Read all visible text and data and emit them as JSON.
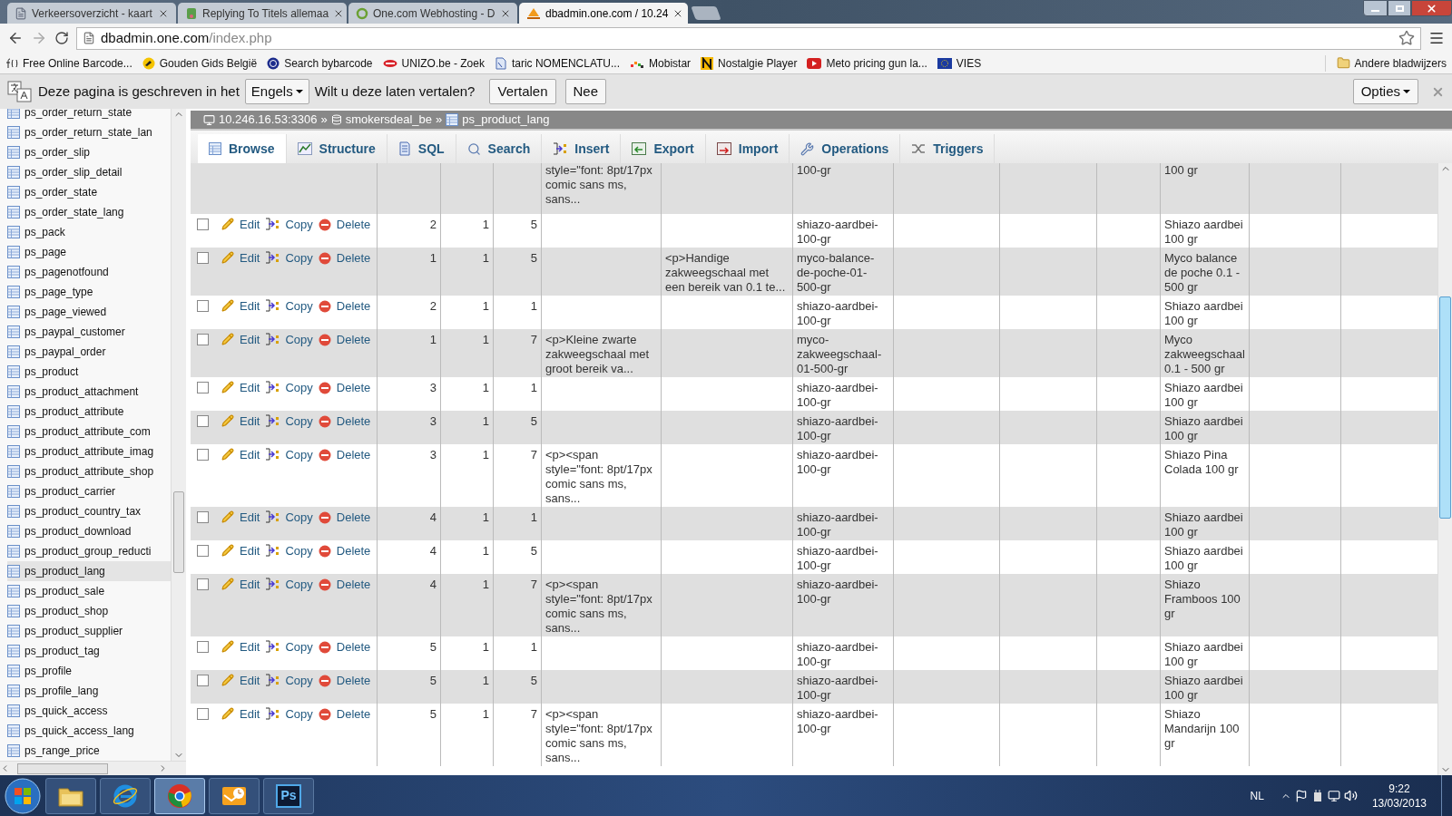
{
  "browser": {
    "tabs": [
      {
        "title": "Verkeersoverzicht - kaart",
        "kind": "page",
        "selected": false
      },
      {
        "title": "Replying To Titels allemaa",
        "kind": "forum",
        "selected": false
      },
      {
        "title": "One.com Webhosting - D",
        "kind": "ring",
        "selected": false
      },
      {
        "title": "dbadmin.one.com / 10.24",
        "kind": "pma",
        "selected": true
      }
    ],
    "url_host": "dbadmin.one.com",
    "url_path": "/index.php",
    "bookmarks": [
      {
        "label": "Free Online Barcode...",
        "kind": "fx"
      },
      {
        "label": "Gouden Gids België",
        "kind": "gids"
      },
      {
        "label": "Search bybarcode",
        "kind": "gs"
      },
      {
        "label": "UNIZO.be - Zoek",
        "kind": "unizo"
      },
      {
        "label": "taric NOMENCLATU...",
        "kind": "taric"
      },
      {
        "label": "Mobistar",
        "kind": "mobistar"
      },
      {
        "label": "Nostalgie Player",
        "kind": "nostalgie"
      },
      {
        "label": "Meto pricing gun la...",
        "kind": "youtube"
      },
      {
        "label": "VIES",
        "kind": "eu"
      }
    ],
    "other_bookmarks": "Andere bladwijzers"
  },
  "translate_bar": {
    "message": "Deze pagina is geschreven in het",
    "language": "Engels",
    "question": "Wilt u deze laten vertalen?",
    "buttons": [
      "Vertalen",
      "Nee"
    ],
    "options": "Opties"
  },
  "sidebar": {
    "items": [
      {
        "label": "ps_order_return_state",
        "selected": false
      },
      {
        "label": "ps_order_return_state_lan",
        "selected": false
      },
      {
        "label": "ps_order_slip",
        "selected": false
      },
      {
        "label": "ps_order_slip_detail",
        "selected": false
      },
      {
        "label": "ps_order_state",
        "selected": false
      },
      {
        "label": "ps_order_state_lang",
        "selected": false
      },
      {
        "label": "ps_pack",
        "selected": false
      },
      {
        "label": "ps_page",
        "selected": false
      },
      {
        "label": "ps_pagenotfound",
        "selected": false
      },
      {
        "label": "ps_page_type",
        "selected": false
      },
      {
        "label": "ps_page_viewed",
        "selected": false
      },
      {
        "label": "ps_paypal_customer",
        "selected": false
      },
      {
        "label": "ps_paypal_order",
        "selected": false
      },
      {
        "label": "ps_product",
        "selected": false
      },
      {
        "label": "ps_product_attachment",
        "selected": false
      },
      {
        "label": "ps_product_attribute",
        "selected": false
      },
      {
        "label": "ps_product_attribute_com",
        "selected": false
      },
      {
        "label": "ps_product_attribute_imag",
        "selected": false
      },
      {
        "label": "ps_product_attribute_shop",
        "selected": false
      },
      {
        "label": "ps_product_carrier",
        "selected": false
      },
      {
        "label": "ps_product_country_tax",
        "selected": false
      },
      {
        "label": "ps_product_download",
        "selected": false
      },
      {
        "label": "ps_product_group_reducti",
        "selected": false
      },
      {
        "label": "ps_product_lang",
        "selected": true
      },
      {
        "label": "ps_product_sale",
        "selected": false
      },
      {
        "label": "ps_product_shop",
        "selected": false
      },
      {
        "label": "ps_product_supplier",
        "selected": false
      },
      {
        "label": "ps_product_tag",
        "selected": false
      },
      {
        "label": "ps_profile",
        "selected": false
      },
      {
        "label": "ps_profile_lang",
        "selected": false
      },
      {
        "label": "ps_quick_access",
        "selected": false
      },
      {
        "label": "ps_quick_access_lang",
        "selected": false
      },
      {
        "label": "ps_range_price",
        "selected": false
      }
    ]
  },
  "breadcrumb": [
    {
      "kind": "server",
      "label": "10.246.16.53:3306"
    },
    {
      "kind": "separator",
      "label": "»"
    },
    {
      "kind": "database",
      "label": "smokersdeal_be"
    },
    {
      "kind": "separator",
      "label": "»"
    },
    {
      "kind": "table",
      "label": "ps_product_lang"
    }
  ],
  "tabs": [
    {
      "label": "Browse",
      "kind": "browse",
      "selected": true
    },
    {
      "label": "Structure",
      "kind": "structure",
      "selected": false
    },
    {
      "label": "SQL",
      "kind": "sql",
      "selected": false
    },
    {
      "label": "Search",
      "kind": "search",
      "selected": false
    },
    {
      "label": "Insert",
      "kind": "insert",
      "selected": false
    },
    {
      "label": "Export",
      "kind": "export",
      "selected": false
    },
    {
      "label": "Import",
      "kind": "import",
      "selected": false
    },
    {
      "label": "Operations",
      "kind": "operations",
      "selected": false
    },
    {
      "label": "Triggers",
      "kind": "triggers",
      "selected": false
    }
  ],
  "table": {
    "rows": [
      {
        "kind": "partial",
        "cells": [
          null,
          null,
          null,
          "style=\"font: 8pt/17px comic sans ms, sans...",
          null,
          "100-gr",
          null,
          null,
          null,
          "100 gr",
          null,
          null
        ]
      },
      {
        "kind": "row",
        "checked": false,
        "actions": [
          "Edit",
          "Copy",
          "Delete"
        ],
        "cells": [
          "2",
          "1",
          "5",
          null,
          null,
          "shiazo-aardbei-100-gr",
          null,
          null,
          null,
          "Shiazo aardbei 100 gr",
          null,
          null
        ]
      },
      {
        "kind": "row",
        "checked": false,
        "actions": [
          "Edit",
          "Copy",
          "Delete"
        ],
        "cells": [
          "1",
          "1",
          "5",
          null,
          "<p>Handige zakweegschaal met een bereik van 0.1 te...",
          "myco-balance-de-poche-01-500-gr",
          null,
          null,
          null,
          "Myco balance de poche 0.1 - 500 gr",
          null,
          null
        ]
      },
      {
        "kind": "row",
        "checked": false,
        "actions": [
          "Edit",
          "Copy",
          "Delete"
        ],
        "cells": [
          "2",
          "1",
          "1",
          null,
          null,
          "shiazo-aardbei-100-gr",
          null,
          null,
          null,
          "Shiazo aardbei 100 gr",
          null,
          null
        ]
      },
      {
        "kind": "row",
        "checked": false,
        "actions": [
          "Edit",
          "Copy",
          "Delete"
        ],
        "cells": [
          "1",
          "1",
          "7",
          "<p>Kleine zwarte zakweegschaal met groot bereik va...",
          null,
          "myco-zakweegschaal-01-500-gr",
          null,
          null,
          null,
          "Myco zakweegschaal 0.1 - 500 gr",
          null,
          null
        ]
      },
      {
        "kind": "row",
        "checked": false,
        "actions": [
          "Edit",
          "Copy",
          "Delete"
        ],
        "cells": [
          "3",
          "1",
          "1",
          null,
          null,
          "shiazo-aardbei-100-gr",
          null,
          null,
          null,
          "Shiazo aardbei 100 gr",
          null,
          null
        ]
      },
      {
        "kind": "row",
        "checked": false,
        "actions": [
          "Edit",
          "Copy",
          "Delete"
        ],
        "cells": [
          "3",
          "1",
          "5",
          null,
          null,
          "shiazo-aardbei-100-gr",
          null,
          null,
          null,
          "Shiazo aardbei 100 gr",
          null,
          null
        ]
      },
      {
        "kind": "row",
        "checked": false,
        "actions": [
          "Edit",
          "Copy",
          "Delete"
        ],
        "cells": [
          "3",
          "1",
          "7",
          "<p><span style=\"font: 8pt/17px comic sans ms, sans...",
          null,
          "shiazo-aardbei-100-gr",
          null,
          null,
          null,
          "Shiazo Pina Colada 100 gr",
          null,
          null
        ]
      },
      {
        "kind": "row",
        "checked": false,
        "actions": [
          "Edit",
          "Copy",
          "Delete"
        ],
        "cells": [
          "4",
          "1",
          "1",
          null,
          null,
          "shiazo-aardbei-100-gr",
          null,
          null,
          null,
          "Shiazo aardbei 100 gr",
          null,
          null
        ]
      },
      {
        "kind": "row",
        "checked": false,
        "actions": [
          "Edit",
          "Copy",
          "Delete"
        ],
        "cells": [
          "4",
          "1",
          "5",
          null,
          null,
          "shiazo-aardbei-100-gr",
          null,
          null,
          null,
          "Shiazo aardbei 100 gr",
          null,
          null
        ]
      },
      {
        "kind": "row",
        "checked": false,
        "actions": [
          "Edit",
          "Copy",
          "Delete"
        ],
        "cells": [
          "4",
          "1",
          "7",
          "<p><span style=\"font: 8pt/17px comic sans ms, sans...",
          null,
          "shiazo-aardbei-100-gr",
          null,
          null,
          null,
          "Shiazo Framboos 100 gr",
          null,
          null
        ]
      },
      {
        "kind": "row",
        "checked": false,
        "actions": [
          "Edit",
          "Copy",
          "Delete"
        ],
        "cells": [
          "5",
          "1",
          "1",
          null,
          null,
          "shiazo-aardbei-100-gr",
          null,
          null,
          null,
          "Shiazo aardbei 100 gr",
          null,
          null
        ]
      },
      {
        "kind": "row",
        "checked": false,
        "actions": [
          "Edit",
          "Copy",
          "Delete"
        ],
        "cells": [
          "5",
          "1",
          "5",
          null,
          null,
          "shiazo-aardbei-100-gr",
          null,
          null,
          null,
          "Shiazo aardbei 100 gr",
          null,
          null
        ]
      },
      {
        "kind": "row",
        "checked": false,
        "actions": [
          "Edit",
          "Copy",
          "Delete"
        ],
        "cells": [
          "5",
          "1",
          "7",
          "<p><span style=\"font: 8pt/17px comic sans ms, sans...",
          null,
          "shiazo-aardbei-100-gr",
          null,
          null,
          null,
          "Shiazo Mandarijn 100 gr",
          null,
          null
        ]
      }
    ]
  },
  "taskbar": {
    "apps": [
      {
        "kind": "explorer",
        "selected": false
      },
      {
        "kind": "ie",
        "selected": false
      },
      {
        "kind": "chrome",
        "selected": true
      },
      {
        "kind": "outlook",
        "selected": false
      },
      {
        "kind": "photoshop",
        "label": "Ps",
        "selected": false
      }
    ],
    "language": "NL",
    "time": "9:22",
    "date": "13/03/2013"
  }
}
